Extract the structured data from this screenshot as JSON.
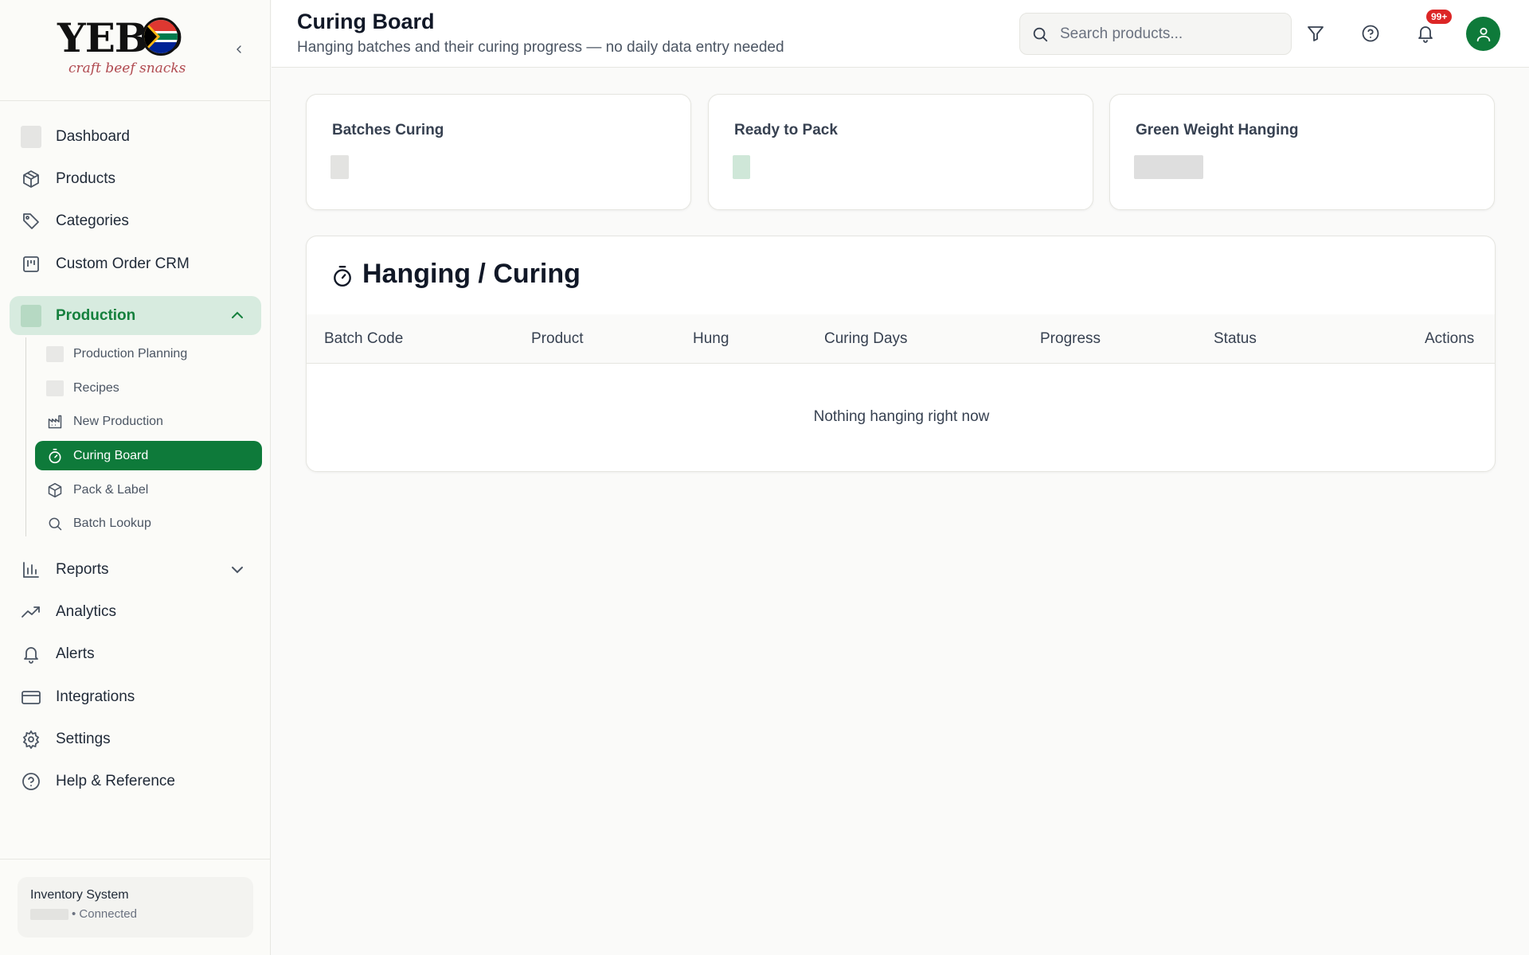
{
  "brand": {
    "wordmark": "YEBO",
    "tagline": "craft beef snacks"
  },
  "sidebar": {
    "items": [
      {
        "label": "Dashboard",
        "icon": "placeholder-icon"
      },
      {
        "label": "Products",
        "icon": "box-icon"
      },
      {
        "label": "Categories",
        "icon": "tag-icon"
      },
      {
        "label": "Custom Order CRM",
        "icon": "kanban-icon"
      },
      {
        "label": "Production",
        "icon": "placeholder-icon",
        "expanded": true,
        "active": true
      },
      {
        "label": "Reports",
        "icon": "bar-chart-icon"
      },
      {
        "label": "Analytics",
        "icon": "trending-up-icon"
      },
      {
        "label": "Alerts",
        "icon": "bell-icon"
      },
      {
        "label": "Integrations",
        "icon": "card-icon"
      },
      {
        "label": "Settings",
        "icon": "gear-icon"
      },
      {
        "label": "Help & Reference",
        "icon": "help-circle-icon"
      }
    ],
    "production_sub": [
      {
        "label": "Production Planning",
        "icon": "placeholder-icon"
      },
      {
        "label": "Recipes",
        "icon": "placeholder-icon"
      },
      {
        "label": "New Production",
        "icon": "factory-icon"
      },
      {
        "label": "Curing Board",
        "icon": "timer-icon",
        "active": true
      },
      {
        "label": "Pack & Label",
        "icon": "box-icon"
      },
      {
        "label": "Batch Lookup",
        "icon": "search-icon"
      }
    ],
    "footer": {
      "title": "Inventory System",
      "status": "• Connected"
    }
  },
  "header": {
    "title": "Curing Board",
    "subtitle": "Hanging batches and their curing progress — no daily data entry needed",
    "search_placeholder": "Search products...",
    "notification_count": "99+"
  },
  "stats": [
    {
      "label": "Batches Curing"
    },
    {
      "label": "Ready to Pack"
    },
    {
      "label": "Green Weight Hanging"
    }
  ],
  "table": {
    "title": "Hanging / Curing",
    "columns": [
      "Batch Code",
      "Product",
      "Hung",
      "Curing Days",
      "Progress",
      "Status",
      "Actions"
    ],
    "rows": [],
    "empty_message": "Nothing hanging right now"
  },
  "colors": {
    "accent": "#0e7a3a",
    "accent_light": "#d7ebdf",
    "badge": "#dc2626"
  }
}
